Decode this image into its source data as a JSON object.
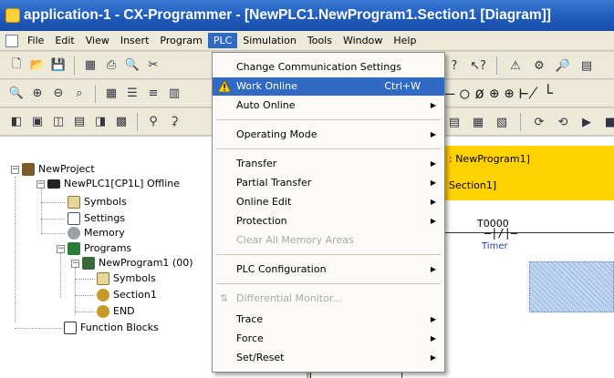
{
  "window": {
    "title": "application-1 - CX-Programmer - [NewPLC1.NewProgram1.Section1 [Diagram]]"
  },
  "menubar": {
    "items": [
      "File",
      "Edit",
      "View",
      "Insert",
      "Program",
      "PLC",
      "Simulation",
      "Tools",
      "Window",
      "Help"
    ],
    "active": "PLC"
  },
  "plc_menu": {
    "items": [
      {
        "label": "Change Communication Settings"
      },
      {
        "label": "Work Online",
        "shortcut": "Ctrl+W",
        "icon": "warning-icon",
        "highlighted": true
      },
      {
        "label": "Auto Online",
        "submenu": true
      },
      {
        "label": "Operating Mode",
        "submenu": true
      },
      {
        "label": "Transfer",
        "submenu": true
      },
      {
        "label": "Partial Transfer",
        "submenu": true
      },
      {
        "label": "Online Edit",
        "submenu": true
      },
      {
        "label": "Protection",
        "submenu": true
      },
      {
        "label": "Clear All Memory Areas",
        "disabled": true
      },
      {
        "label": "PLC Configuration",
        "submenu": true
      },
      {
        "label": "Differential Monitor...",
        "disabled": true
      },
      {
        "label": "Trace",
        "submenu": true
      },
      {
        "label": "Force",
        "submenu": true
      },
      {
        "label": "Set/Reset",
        "submenu": true
      }
    ],
    "arrow_glyph": "▶"
  },
  "project_tree": {
    "root": "NewProject",
    "plc": "NewPLC1[CP1L] Offline",
    "symbols": "Symbols",
    "settings": "Settings",
    "memory": "Memory",
    "programs": "Programs",
    "program": "NewProgram1 (00)",
    "program_symbols": "Symbols",
    "section": "Section1",
    "end": "END",
    "function_blocks": "Function Blocks"
  },
  "diagram": {
    "program_label": ": NewProgram1]",
    "section_label": "Section1]",
    "contact_address": "T0000",
    "contact_symbol": "—|/|—",
    "contact_comment": "Timer"
  },
  "colors": {
    "accent": "#316ac5",
    "title_blue": "#1f5bbd",
    "diagram_header": "#ffd200",
    "selection_fill": "#a8c4ea"
  }
}
